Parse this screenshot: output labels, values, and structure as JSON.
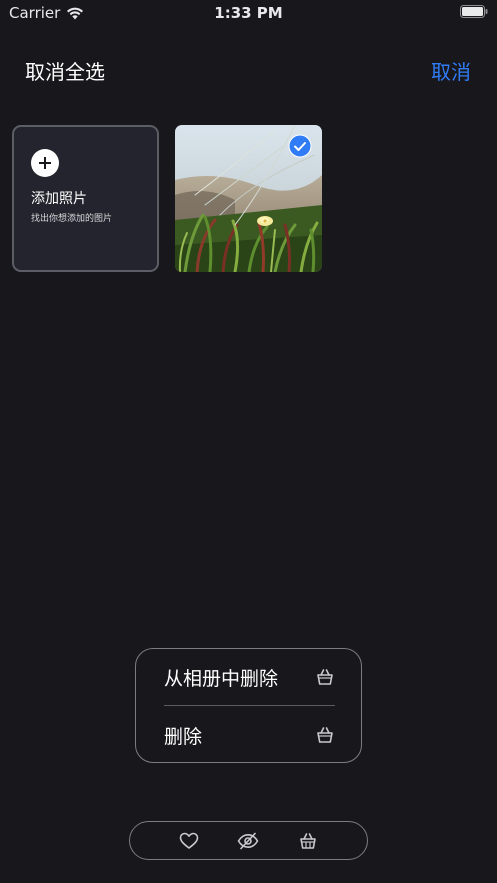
{
  "status_bar": {
    "carrier": "Carrier",
    "time": "1:33 PM"
  },
  "nav": {
    "left_label": "取消全选",
    "right_label": "取消"
  },
  "add_card": {
    "title": "添加照片",
    "subtitle": "找出你想添加的图片",
    "icon": "plus-icon"
  },
  "photos": [
    {
      "selected": true,
      "subject": "yellow flower among green grass"
    }
  ],
  "delete_menu": {
    "items": [
      {
        "label": "从相册中删除",
        "icon": "basket-icon"
      },
      {
        "label": "删除",
        "icon": "basket-icon"
      }
    ]
  },
  "toolbar": {
    "items": [
      {
        "icon": "heart-icon"
      },
      {
        "icon": "eye-slash-icon"
      },
      {
        "icon": "basket-icon"
      }
    ]
  },
  "colors": {
    "background": "#18171b",
    "accent": "#2f7cf6",
    "border": "#7b7c84",
    "card": "#23242d"
  }
}
